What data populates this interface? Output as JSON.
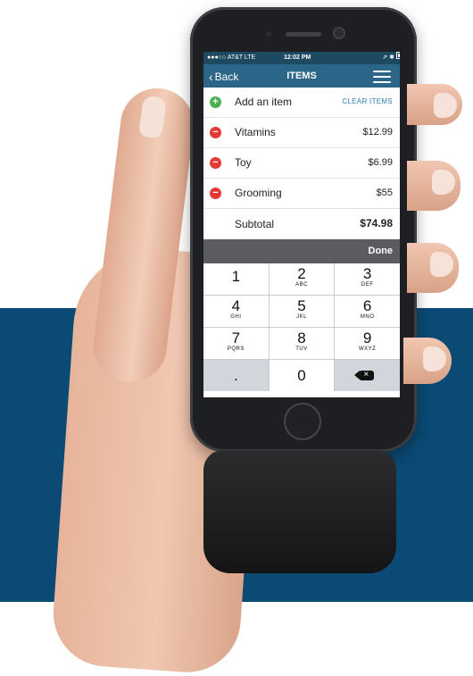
{
  "status_bar": {
    "carrier": "●●●○○ AT&T  LTE",
    "time": "12:02 PM",
    "indicators": "⇗ ✱"
  },
  "nav": {
    "back_label": "Back",
    "title": "ITEMS"
  },
  "add_item": {
    "label": "Add an item",
    "clear_label": "CLEAR ITEMS"
  },
  "items": [
    {
      "name": "Vitamins",
      "price": "$12.99"
    },
    {
      "name": "Toy",
      "price": "$6.99"
    },
    {
      "name": "Grooming",
      "price": "$55"
    }
  ],
  "subtotal": {
    "label": "Subtotal",
    "value": "$74.98"
  },
  "done_label": "Done",
  "keypad": [
    {
      "num": "1",
      "letters": ""
    },
    {
      "num": "2",
      "letters": "ABC"
    },
    {
      "num": "3",
      "letters": "DEF"
    },
    {
      "num": "4",
      "letters": "GHI"
    },
    {
      "num": "5",
      "letters": "JKL"
    },
    {
      "num": "6",
      "letters": "MNO"
    },
    {
      "num": "7",
      "letters": "PQRS"
    },
    {
      "num": "8",
      "letters": "TUV"
    },
    {
      "num": "9",
      "letters": "WXYZ"
    },
    {
      "num": ".",
      "letters": ""
    },
    {
      "num": "0",
      "letters": ""
    }
  ],
  "colors": {
    "nav": "#2b6688",
    "status": "#1d4a60",
    "background_band": "#0b4a74",
    "add": "#4caf50",
    "remove": "#e53935",
    "link": "#2f7fb6"
  },
  "icons": {
    "back": "chevron-left-icon",
    "menu": "hamburger-menu-icon",
    "add": "plus-circle-icon",
    "remove": "minus-circle-icon",
    "delete": "backspace-icon"
  }
}
